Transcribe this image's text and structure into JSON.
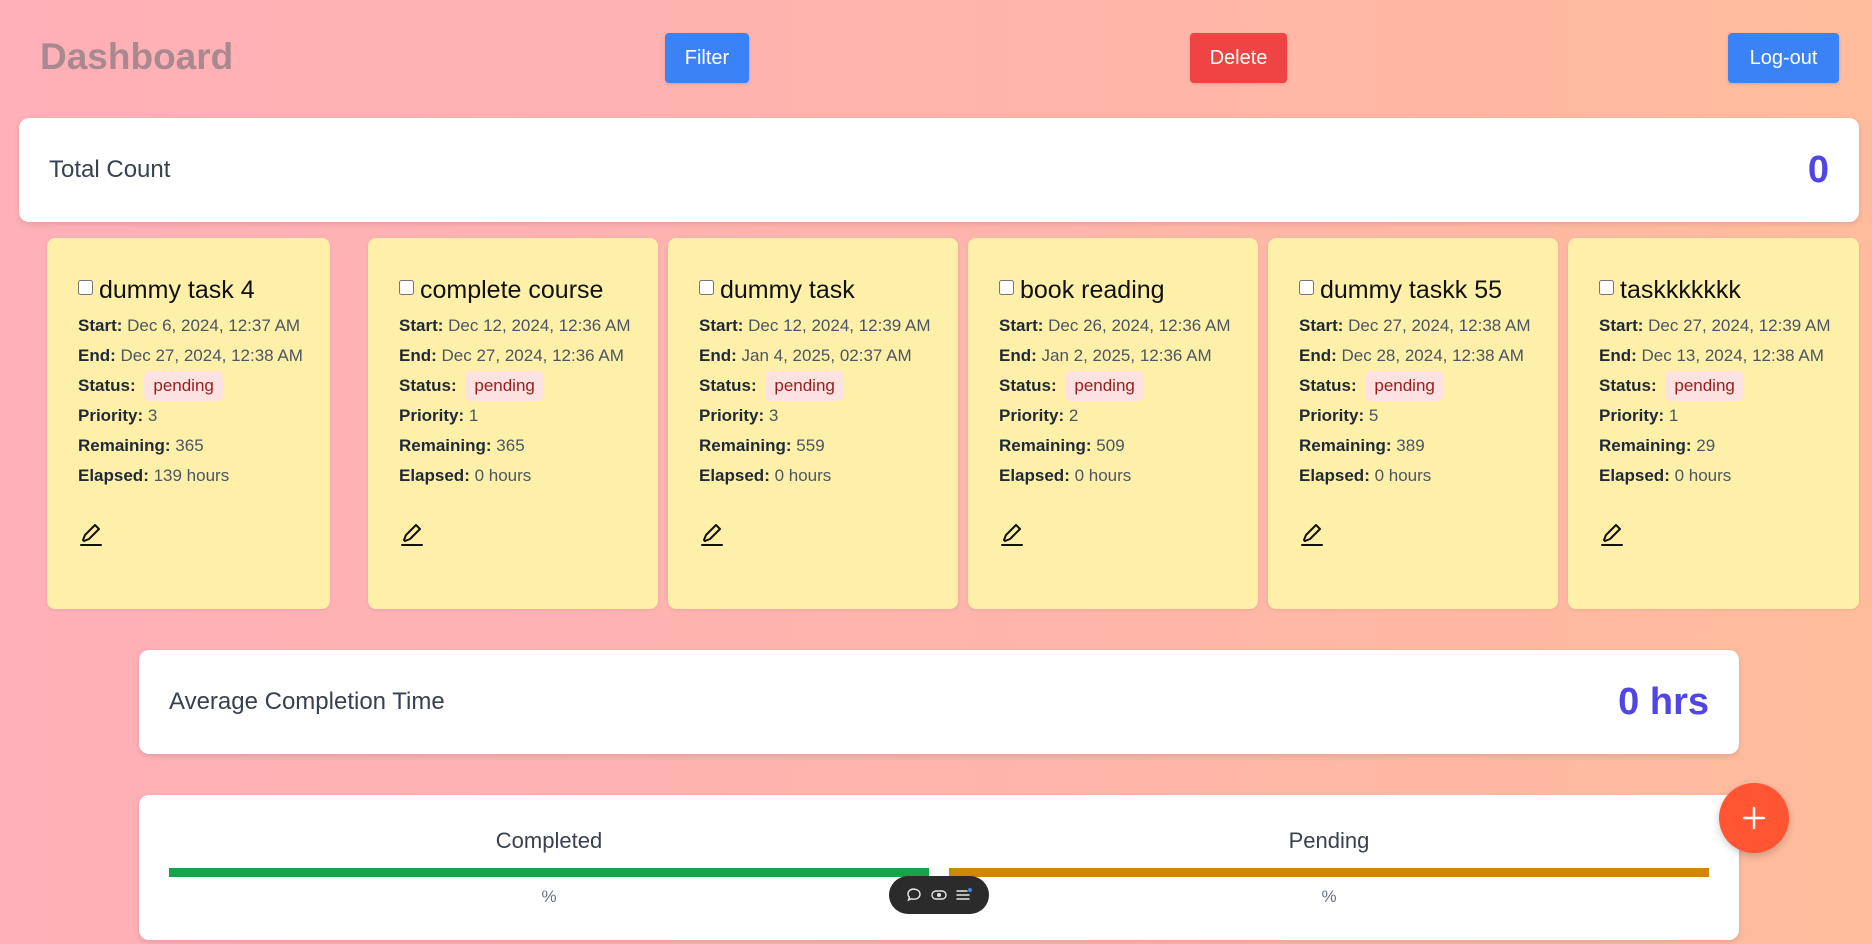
{
  "header": {
    "title": "Dashboard",
    "filter_label": "Filter",
    "delete_label": "Delete",
    "logout_label": "Log-out"
  },
  "stats": {
    "total_label": "Total Count",
    "total_value": "0",
    "avg_label": "Average Completion Time",
    "avg_value": "0 hrs"
  },
  "field_labels": {
    "start": "Start:",
    "end": "End:",
    "status": "Status:",
    "priority": "Priority:",
    "remaining": "Remaining:",
    "elapsed": "Elapsed:"
  },
  "tasks": [
    {
      "title": "dummy task 4",
      "start": "Dec 6, 2024, 12:37 AM",
      "end": "Dec 27, 2024, 12:38 AM",
      "status": "pending",
      "priority": "3",
      "remaining": "365",
      "elapsed": "139 hours"
    },
    {
      "title": "complete course",
      "start": "Dec 12, 2024, 12:36 AM",
      "end": "Dec 27, 2024, 12:36 AM",
      "status": "pending",
      "priority": "1",
      "remaining": "365",
      "elapsed": "0 hours"
    },
    {
      "title": "dummy task",
      "start": "Dec 12, 2024, 12:39 AM",
      "end": "Jan 4, 2025, 02:37 AM",
      "status": "pending",
      "priority": "3",
      "remaining": "559",
      "elapsed": "0 hours"
    },
    {
      "title": "book reading",
      "start": "Dec 26, 2024, 12:36 AM",
      "end": "Jan 2, 2025, 12:36 AM",
      "status": "pending",
      "priority": "2",
      "remaining": "509",
      "elapsed": "0 hours"
    },
    {
      "title": "dummy taskk 55",
      "start": "Dec 27, 2024, 12:38 AM",
      "end": "Dec 28, 2024, 12:38 AM",
      "status": "pending",
      "priority": "5",
      "remaining": "389",
      "elapsed": "0 hours"
    },
    {
      "title": "taskkkkkkk",
      "start": "Dec 27, 2024, 12:39 AM",
      "end": "Dec 13, 2024, 12:38 AM",
      "status": "pending",
      "priority": "1",
      "remaining": "29",
      "elapsed": "0 hours"
    }
  ],
  "progress": {
    "completed_label": "Completed",
    "completed_pct": "%",
    "pending_label": "Pending",
    "pending_pct": "%"
  },
  "colors": {
    "completed_bar": "#16a34a",
    "pending_bar": "#ca8a04",
    "accent": "#4f46e5",
    "card_bg": "#fef0a8"
  },
  "icons": {
    "fab": "plus-icon",
    "card_action": "pencil-icon",
    "toolbar": [
      "chat-icon",
      "eye-icon",
      "list-icon"
    ]
  }
}
